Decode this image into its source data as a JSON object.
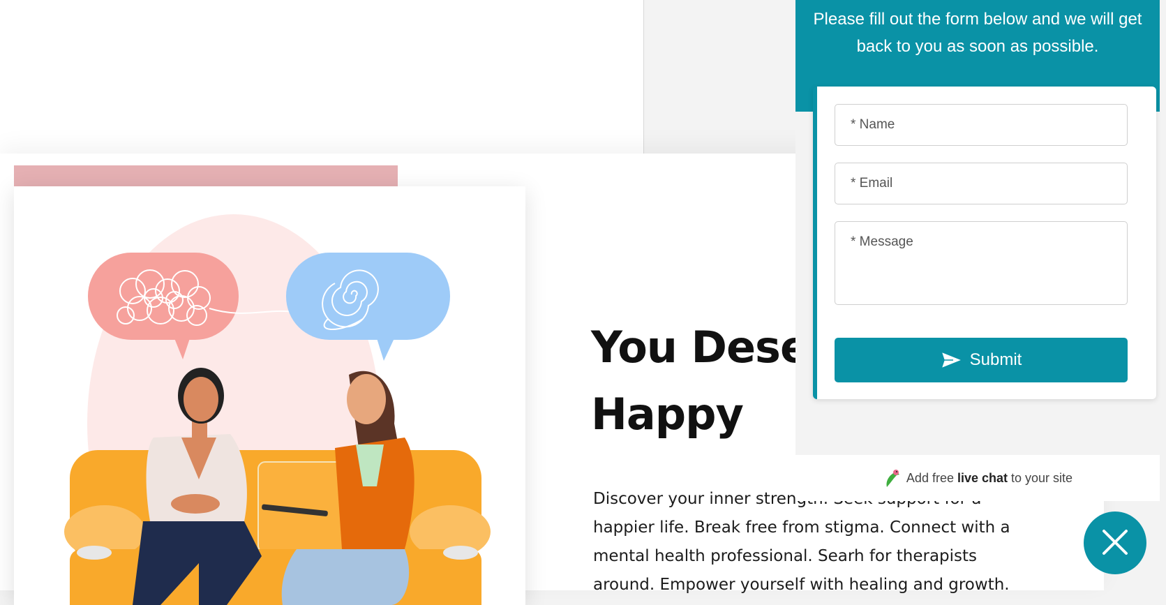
{
  "hero": {
    "title_line1": "You Deser",
    "title_line2": "Happy",
    "description": "Discover your inner strength. Seek support for a happier life. Break free from stigma. Connect with a mental health professional. Searh for therapists around. Empower yourself with healing and growth."
  },
  "widget": {
    "intro": "Please fill out the form below and we will get back to you as soon as possible.",
    "name_placeholder": "* Name",
    "email_placeholder": "* Email",
    "message_placeholder": "* Message",
    "submit_label": "Submit",
    "footer_prefix": "Add free ",
    "footer_bold": "live chat",
    "footer_suffix": " to your site"
  },
  "colors": {
    "accent": "#0a92a6",
    "pink_bar": "#e5b0b3"
  },
  "icons": {
    "submit": "send-icon",
    "footer": "bird-logo-icon",
    "fab": "close-icon"
  }
}
